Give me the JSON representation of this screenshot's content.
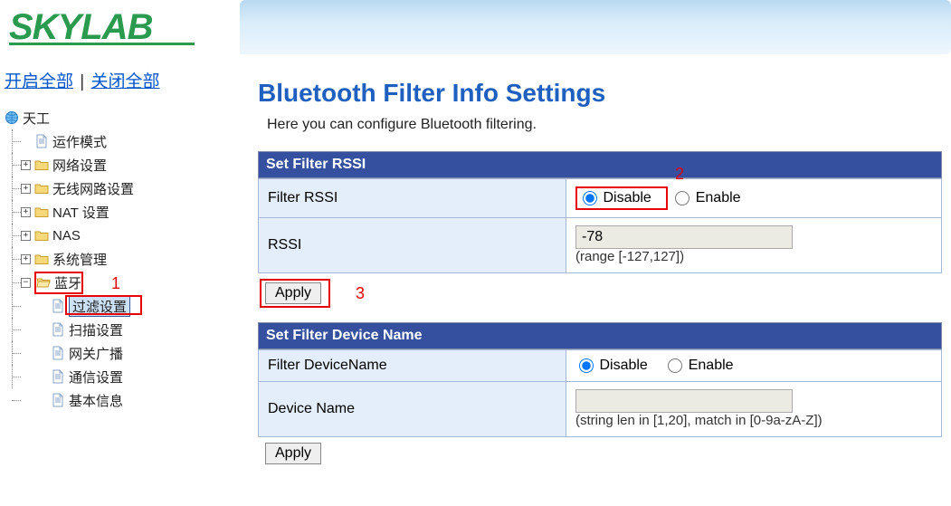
{
  "logo_text": "SKYLAB",
  "top_links": {
    "open_all": "开启全部",
    "close_all": "关闭全部"
  },
  "tree": {
    "root": "天工",
    "items": [
      {
        "label": "运作模式"
      },
      {
        "label": "网络设置"
      },
      {
        "label": "无线网路设置"
      },
      {
        "label": "NAT 设置"
      },
      {
        "label": "NAS"
      },
      {
        "label": "系统管理"
      },
      {
        "label": "蓝牙"
      }
    ],
    "bluetooth_children": [
      {
        "label": "过滤设置"
      },
      {
        "label": "扫描设置"
      },
      {
        "label": "网关广播"
      },
      {
        "label": "通信设置"
      },
      {
        "label": "基本信息"
      }
    ]
  },
  "page": {
    "title": "Bluetooth Filter Info Settings",
    "subtitle": "Here you can configure Bluetooth filtering."
  },
  "rssi": {
    "section_title": "Set Filter RSSI",
    "row1_label": "Filter RSSI",
    "disable_label": "Disable",
    "enable_label": "Enable",
    "row2_label": "RSSI",
    "value": "-78",
    "hint": "(range [-127,127])",
    "apply_label": "Apply"
  },
  "devname": {
    "section_title": "Set Filter Device Name",
    "row1_label": "Filter DeviceName",
    "disable_label": "Disable",
    "enable_label": "Enable",
    "row2_label": "Device Name",
    "value": "",
    "hint": "(string len in [1,20], match in [0-9a-zA-Z])",
    "apply_label": "Apply"
  },
  "anno": {
    "one": "1",
    "two": "2",
    "three": "3"
  }
}
